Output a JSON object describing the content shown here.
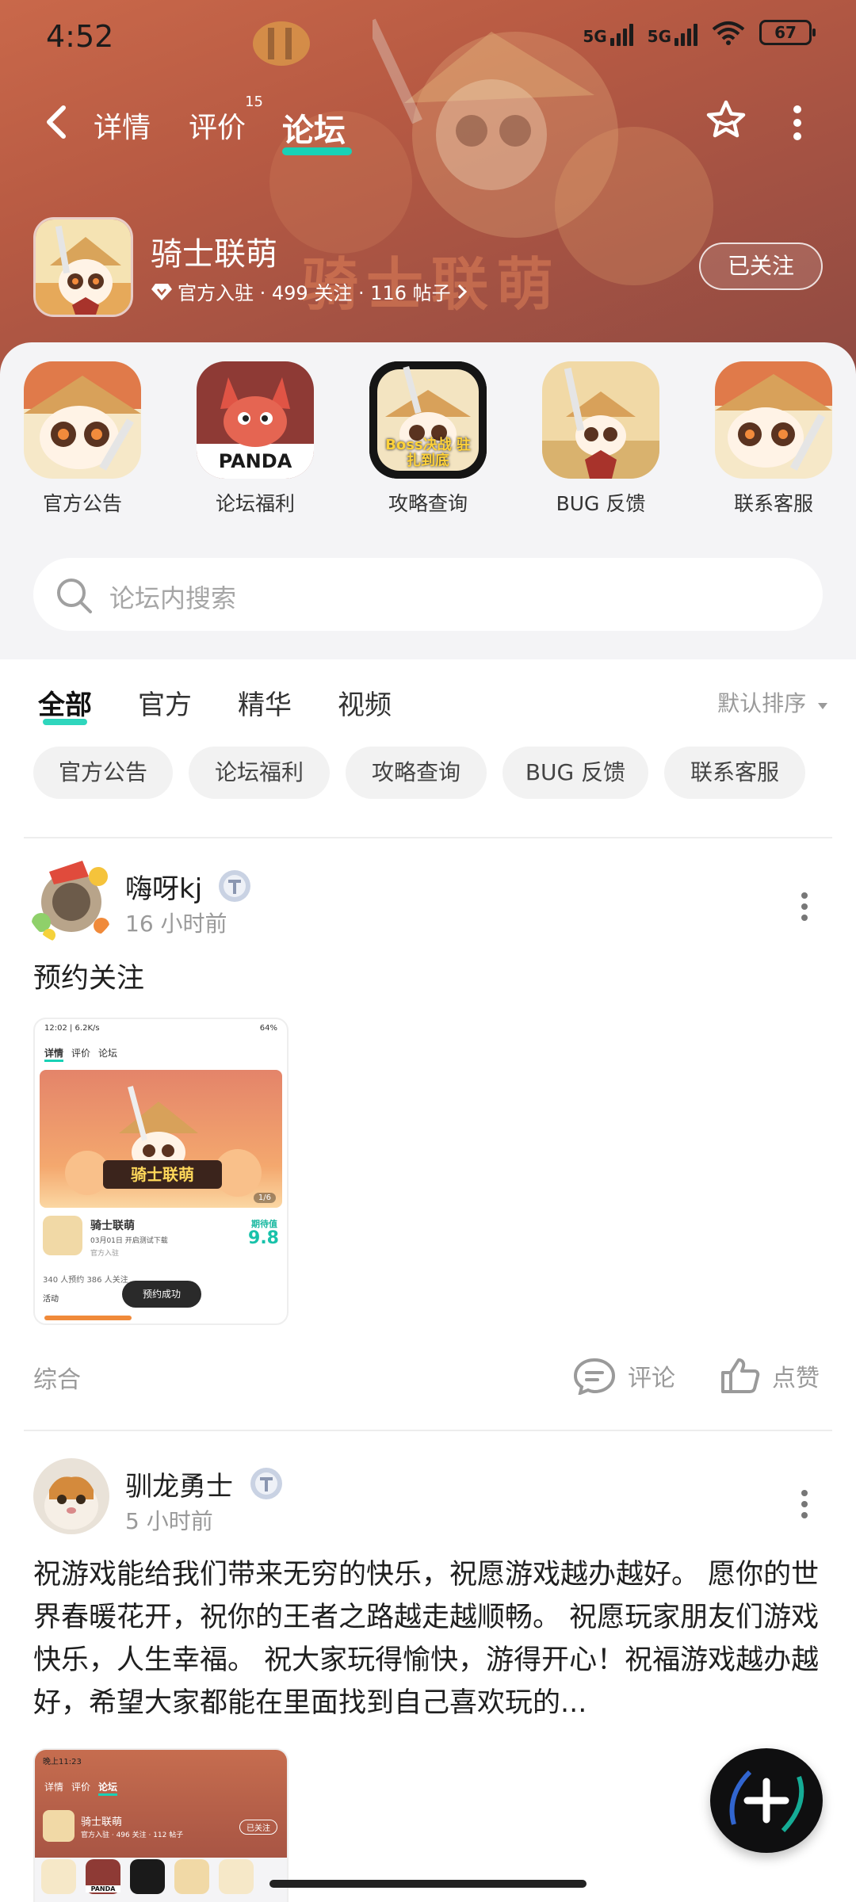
{
  "status_bar": {
    "time": "4:52",
    "net1": "5G",
    "net2": "5G",
    "battery": "67"
  },
  "nav": {
    "tabs": [
      {
        "label": "详情"
      },
      {
        "label": "评价",
        "count": "15"
      },
      {
        "label": "论坛"
      }
    ],
    "active_tab": "论坛"
  },
  "game": {
    "name": "骑士联萌",
    "meta": "官方入驻 · 499 关注 · 116 帖子",
    "follow_label": "已关注"
  },
  "categories": [
    {
      "label": "官方公告"
    },
    {
      "label": "论坛福利",
      "icon_text": "PANDA"
    },
    {
      "label": "攻略查询",
      "icon_text": "Boss决战 驻扎到底"
    },
    {
      "label": "BUG 反馈"
    },
    {
      "label": "联系客服"
    }
  ],
  "search": {
    "placeholder": "论坛内搜索"
  },
  "filter_tabs": [
    {
      "label": "全部"
    },
    {
      "label": "官方"
    },
    {
      "label": "精华"
    },
    {
      "label": "视频"
    }
  ],
  "sort_label": "默认排序",
  "chips": [
    {
      "label": "官方公告"
    },
    {
      "label": "论坛福利"
    },
    {
      "label": "攻略查询"
    },
    {
      "label": "BUG 反馈"
    },
    {
      "label": "联系客服"
    }
  ],
  "posts": [
    {
      "author": "嗨呀kj",
      "time": "16 小时前",
      "text": "预约关注",
      "tag": "综合",
      "comment_label": "评论",
      "like_label": "点赞",
      "thumb": {
        "status": "12:02 | 6.2K/s",
        "battery": "64%",
        "tabs": [
          "详情",
          "评价",
          "论坛"
        ],
        "game_name": "骑士联萌",
        "game_sub": "03月01日 开启测试下载",
        "official": "官方入驻",
        "score_label": "期待值",
        "score": "9.8",
        "stats": "340 人预约   386 人关注",
        "activity": "活动",
        "toast": "预约成功",
        "page": "1/6",
        "logo": "骑士联萌"
      }
    },
    {
      "author": "驯龙勇士",
      "time": "5 小时前",
      "text": "祝游戏能给我们带来无穷的快乐，祝愿游戏越办越好。 愿你的世界春暖花开，祝你的王者之路越走越顺畅。 祝愿玩家朋友们游戏快乐，人生幸福。 祝大家玩得愉快，游得开心！祝福游戏越办越好，希望大家都能在里面找到自己喜欢玩的...",
      "thumb": {
        "status": "晚上11:23",
        "tabs": [
          "详情",
          "评价",
          "论坛"
        ],
        "game_name": "骑士联萌",
        "meta": "官方入驻 · 496 关注 · 112 帖子",
        "follow": "已关注",
        "icon_text": "PANDA"
      }
    }
  ],
  "colors": {
    "accent": "#18d1b6",
    "banner": "#b75a43",
    "bg": "#f4f4f6"
  }
}
